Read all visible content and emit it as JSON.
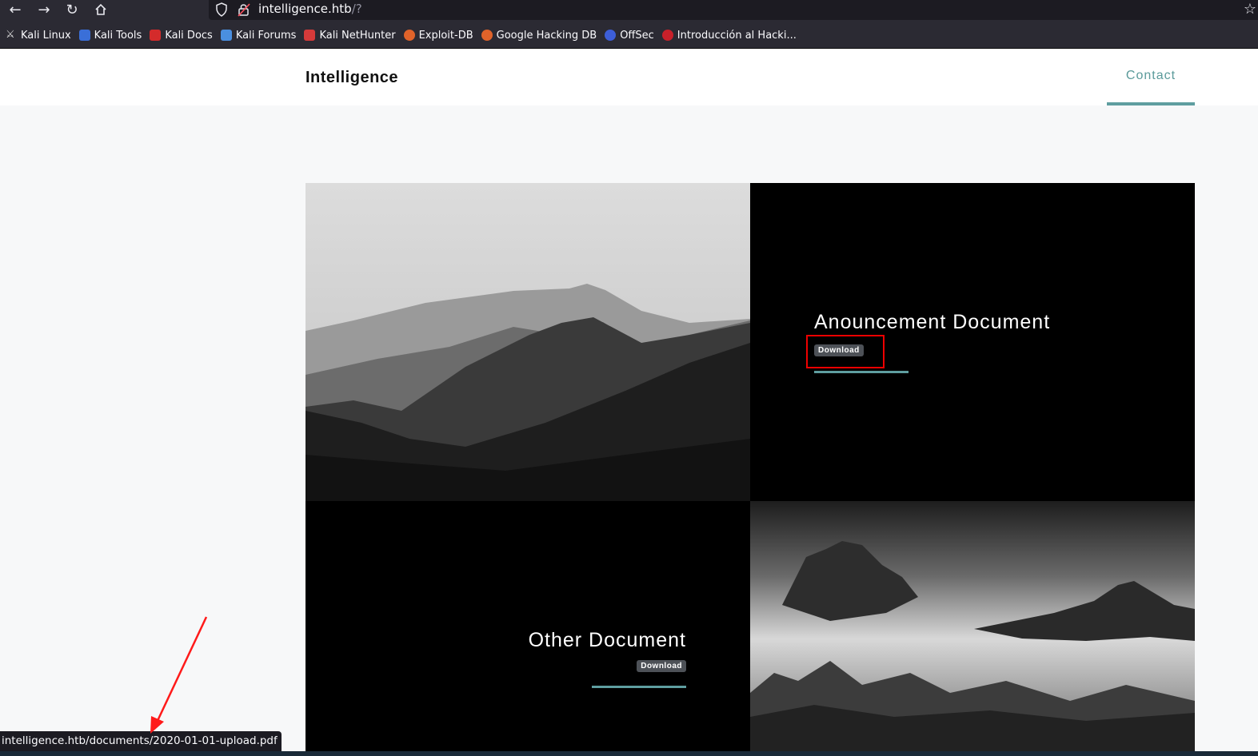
{
  "browser": {
    "url_host": "intelligence.htb",
    "url_path": "/?",
    "bookmarks": [
      {
        "label": "Kali Linux"
      },
      {
        "label": "Kali Tools"
      },
      {
        "label": "Kali Docs"
      },
      {
        "label": "Kali Forums"
      },
      {
        "label": "Kali NetHunter"
      },
      {
        "label": "Exploit-DB"
      },
      {
        "label": "Google Hacking DB"
      },
      {
        "label": "OffSec"
      },
      {
        "label": "Introducción al Hacki..."
      }
    ],
    "status_url": "intelligence.htb/documents/2020-01-01-upload.pdf"
  },
  "site": {
    "brand": "Intelligence",
    "nav_contact": "Contact",
    "doc1": {
      "title": "Anouncement Document",
      "button": "Download"
    },
    "doc2": {
      "title": "Other Document",
      "button": "Download"
    }
  },
  "colors": {
    "accent": "#5f9ea0",
    "highlight": "#e00000"
  }
}
